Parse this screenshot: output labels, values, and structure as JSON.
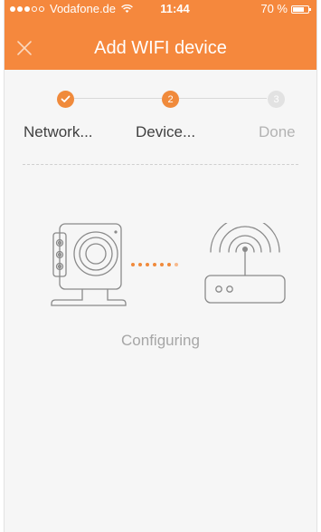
{
  "status_bar": {
    "carrier": "Vodafone.de",
    "time": "11:44",
    "battery": "70 %",
    "battery_level": 0.7,
    "signal_bars_filled": 3,
    "signal_bars_total": 5
  },
  "nav": {
    "title": "Add WIFI device",
    "close_icon": "close-icon"
  },
  "steps": [
    {
      "number": "1",
      "label": "Network...",
      "state": "done"
    },
    {
      "number": "2",
      "label": "Device...",
      "state": "active"
    },
    {
      "number": "3",
      "label": "Done",
      "state": "pending"
    }
  ],
  "illustration": {
    "camera_icon": "camera-icon",
    "router_icon": "router-icon",
    "progress_dots": 7
  },
  "status_text": "Configuring",
  "colors": {
    "accent": "#f5883d",
    "step_active": "#f08a3b",
    "step_pending": "#e2e2e2",
    "background": "#f6f6f6"
  }
}
